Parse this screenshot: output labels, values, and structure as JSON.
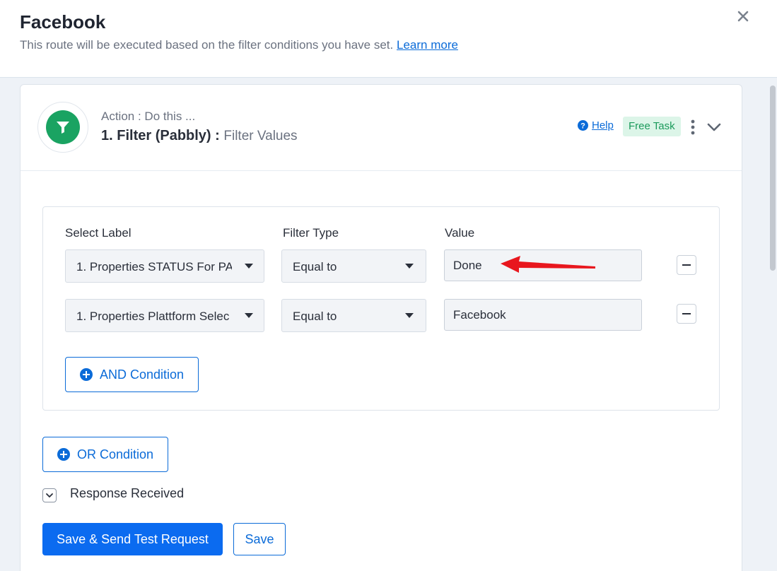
{
  "header": {
    "title": "Facebook",
    "subtitle": "This route will be executed based on the filter conditions you have set.",
    "learn_more": "Learn more"
  },
  "step": {
    "action_line": "Action : Do this ...",
    "title": "1. Filter (Pabbly) :",
    "event": "Filter Values",
    "help_label": "Help",
    "badge": "Free Task",
    "accent_color": "#1aa362"
  },
  "filter": {
    "columns": {
      "label": "Select Label",
      "type": "Filter Type",
      "value": "Value"
    },
    "rows": [
      {
        "label": "1. Properties STATUS For PA",
        "type": "Equal to",
        "value": "Done"
      },
      {
        "label": "1. Properties Plattform Selec",
        "type": "Equal to",
        "value": "Facebook"
      }
    ],
    "and_button": "AND Condition"
  },
  "or_button": "OR Condition",
  "response_label": "Response Received",
  "buttons": {
    "save_send": "Save & Send Test Request",
    "save": "Save"
  },
  "colors": {
    "primary": "#0b6bf0",
    "annotation_arrow": "#e8171e"
  }
}
